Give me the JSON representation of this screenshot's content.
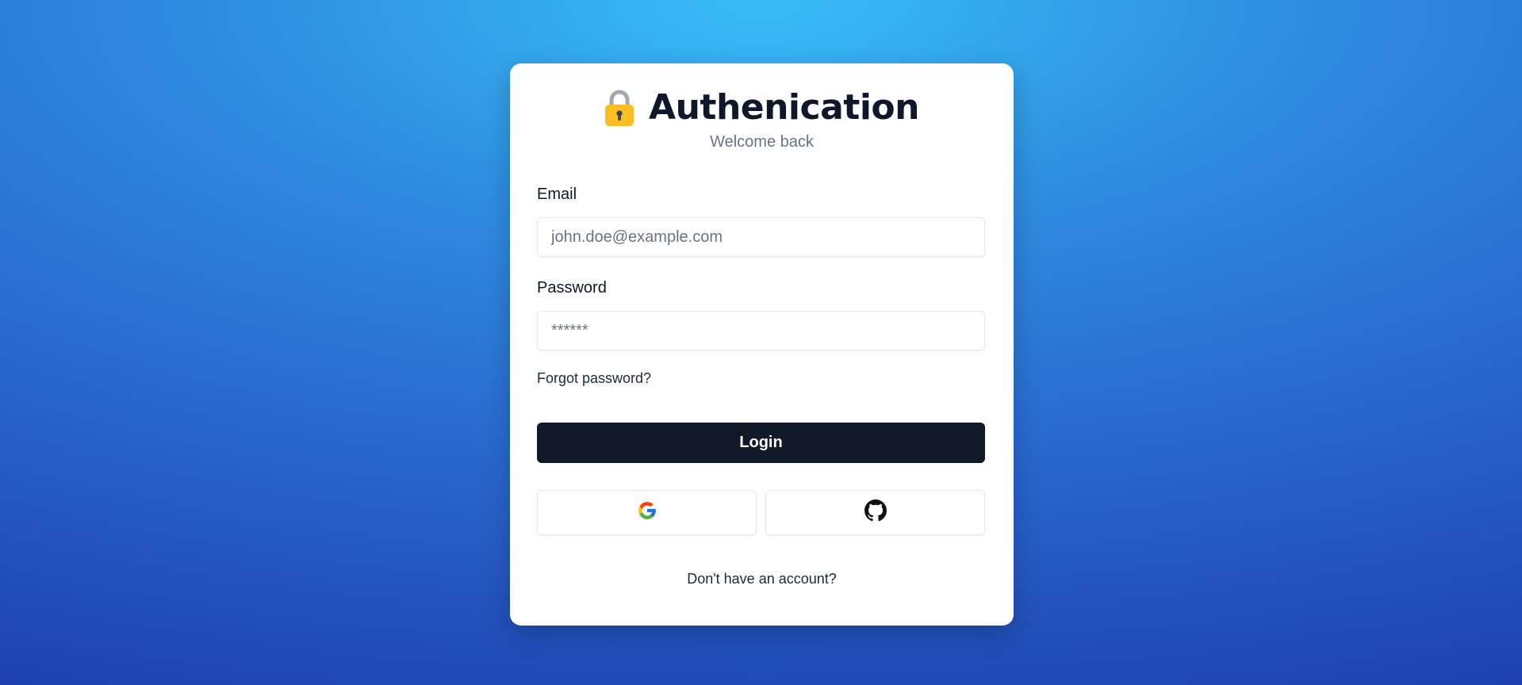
{
  "header": {
    "title": "Authenication",
    "subtitle": "Welcome back",
    "icon": "lock-icon"
  },
  "form": {
    "email": {
      "label": "Email",
      "placeholder": "john.doe@example.com",
      "value": ""
    },
    "password": {
      "label": "Password",
      "placeholder": "******",
      "value": ""
    },
    "forgot_link": "Forgot password?",
    "login_label": "Login"
  },
  "social": {
    "google_icon": "google-icon",
    "github_icon": "github-icon"
  },
  "footer": {
    "signup_text": "Don't have an account?"
  },
  "colors": {
    "background_light": "#38bdf8",
    "background_dark": "#1e40af",
    "card": "#ffffff",
    "primary_button": "#111827",
    "lock_body": "#fbbf24",
    "text_dark": "#0f172a",
    "text_muted": "#64748b"
  }
}
